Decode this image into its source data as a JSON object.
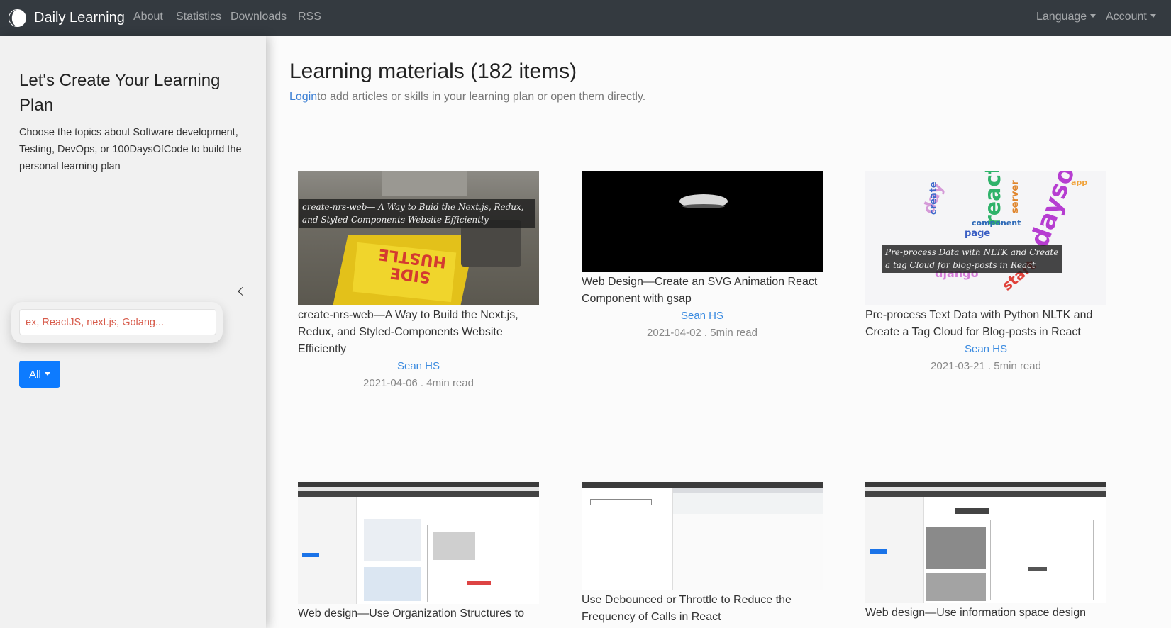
{
  "navbar": {
    "brand": "Daily Learning",
    "links": [
      "About",
      "Statistics",
      "Downloads",
      "RSS"
    ],
    "right": [
      "Language",
      "Account"
    ]
  },
  "sidebar": {
    "title": "Let's Create Your Learning Plan",
    "description": "Choose the topics about Software development, Testing, DevOps, or 100DaysOfCode to build the personal learning plan",
    "search_placeholder": "ex, ReactJS, next.js, Golang...",
    "filter_label": "All"
  },
  "main": {
    "title": "Learning materials (182 items)",
    "login_link": "Login",
    "subtitle_rest": "to add articles or skills in your learning plan or open them directly."
  },
  "cards": [
    {
      "title": "create-nrs-web—A Way to Build the Next.js, Redux, and Styled-Components Website Efficiently",
      "author": "Sean HS",
      "meta": "2021-04-06 . 4min read",
      "thumb_caption": "create-nrs-web— A Way to Buid the Next.js, Redux, and Styled-Components Website Efficiently",
      "thumb_text": "SIDE HUSTLE"
    },
    {
      "title": "Web Design—Create an SVG Animation React Component with gsap",
      "author": "Sean HS",
      "meta": "2021-04-02 . 5min read"
    },
    {
      "title": "Pre-process Text Data with Python NLTK and Create a Tag Cloud for Blog-posts in React",
      "author": "Sean HS",
      "meta": "2021-03-21 . 5min read",
      "thumb_caption": "Pre-process Data with NLTK and Create a tag Cloud for blog-posts in React"
    },
    {
      "title": "Web design—Use Organization Structures to"
    },
    {
      "title": "Use Debounced or Throttle to Reduce the Frequency of Calls in React"
    },
    {
      "title": "Web design—Use information space design"
    }
  ]
}
